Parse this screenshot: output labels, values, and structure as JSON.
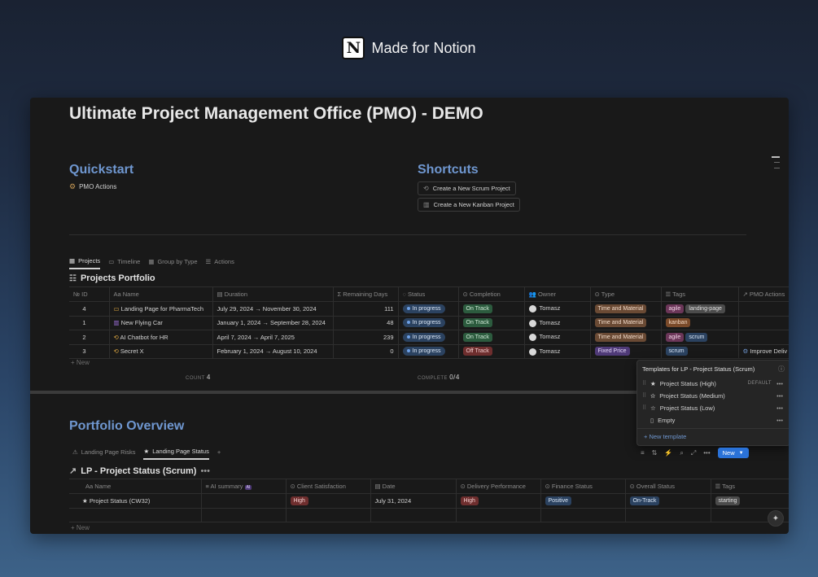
{
  "brand": {
    "text": "Made for Notion"
  },
  "page": {
    "title": "Ultimate Project Management Office (PMO) - DEMO"
  },
  "quickstart": {
    "heading": "Quickstart",
    "link_label": "PMO Actions"
  },
  "shortcuts": {
    "heading": "Shortcuts",
    "buttons": [
      {
        "label": "Create a New Scrum Project"
      },
      {
        "label": "Create a New Kanban Project"
      }
    ]
  },
  "projects_view": {
    "tabs": [
      {
        "label": "Projects"
      },
      {
        "label": "Timeline"
      },
      {
        "label": "Group by Type"
      },
      {
        "label": "Actions"
      }
    ],
    "db_title": "Projects Portfolio",
    "columns": [
      "ID",
      "Name",
      "Duration",
      "Remaining Days",
      "Status",
      "Completion",
      "Owner",
      "Type",
      "Tags",
      "PMO Actions"
    ],
    "rows": [
      {
        "id": "4",
        "name": "Landing Page for PharmaTech",
        "duration": "July 29, 2024 → November 30, 2024",
        "remaining": "111",
        "status": "In progress",
        "completion": "On Track",
        "owner": "Tomasz",
        "type": "Time and Material",
        "tags": [
          "agile",
          "landing-page"
        ],
        "actions": ""
      },
      {
        "id": "1",
        "name": "New Flying Car",
        "duration": "January 1, 2024 → September 28, 2024",
        "remaining": "48",
        "status": "In progress",
        "completion": "On Track",
        "owner": "Tomasz",
        "type": "Time and Material",
        "tags": [
          "kanban"
        ],
        "actions": ""
      },
      {
        "id": "2",
        "name": "AI Chatbot for HR",
        "duration": "April 7, 2024 → April 7, 2025",
        "remaining": "239",
        "status": "In progress",
        "completion": "On Track",
        "owner": "Tomasz",
        "type": "Time and Material",
        "tags": [
          "agile",
          "scrum"
        ],
        "actions": ""
      },
      {
        "id": "3",
        "name": "Secret X",
        "duration": "February 1, 2024 → August 10, 2024",
        "remaining": "0",
        "status": "In progress",
        "completion": "Off Track",
        "owner": "Tomasz",
        "type": "Fixed Price",
        "tags": [
          "scrum"
        ],
        "actions": "Improve Deliv"
      }
    ],
    "new_label": "New",
    "count_label": "COUNT",
    "count_value": "4",
    "complete_label": "COMPLETE",
    "complete_value": "0/4"
  },
  "templates_popup": {
    "title": "Templates for LP - Project Status (Scrum)",
    "items": [
      {
        "label": "Project Status (High)",
        "badge": "DEFAULT"
      },
      {
        "label": "Project Status (Medium)",
        "badge": ""
      },
      {
        "label": "Project Status (Low)",
        "badge": ""
      },
      {
        "label": "Empty",
        "badge": ""
      }
    ],
    "new_template": "New template"
  },
  "overview": {
    "heading": "Portfolio Overview",
    "tabs": [
      {
        "label": "Landing Page Risks"
      },
      {
        "label": "Landing Page Status"
      }
    ],
    "new_button": "New",
    "db_title": "LP - Project Status (Scrum)",
    "columns": [
      "Name",
      "AI summary",
      "Client Satisfaction",
      "Date",
      "Delivery Performance",
      "Finance Status",
      "Overall Status",
      "Tags"
    ],
    "ai_badge": "AI",
    "rows": [
      {
        "name": "Project Status (CW32)",
        "ai": "",
        "client": "High",
        "date": "July 31, 2024",
        "delivery": "High",
        "finance": "Positive",
        "overall": "On-Track",
        "tags": "starting"
      }
    ],
    "new_label": "New"
  },
  "colors": {
    "accent_blue": "#6f97d0",
    "status_blue": "#2b4260",
    "green": "#2c5b3e",
    "red": "#6e2e2e",
    "brown": "#6a4a34",
    "purple": "#4f3a78",
    "pink": "#6b3658",
    "gray": "#4b4b4b",
    "primary_button": "#2a72d8"
  }
}
